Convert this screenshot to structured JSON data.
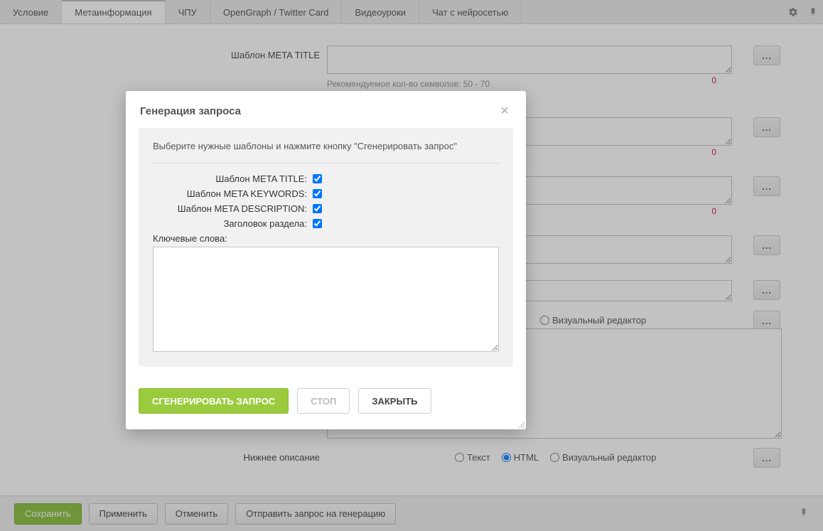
{
  "tabs": [
    {
      "label": "Условие"
    },
    {
      "label": "Метаинформация"
    },
    {
      "label": "ЧПУ"
    },
    {
      "label": "OpenGraph / Twitter Card"
    },
    {
      "label": "Видеоуроки"
    },
    {
      "label": "Чат с нейросетью"
    }
  ],
  "active_tab_index": 1,
  "fields": {
    "meta_title": {
      "label": "Шаблон META TITLE",
      "helper": "Рекомендуемое кол-во символов: 50 - 70",
      "counter": "0"
    },
    "f2": {
      "counter": "0"
    },
    "f3": {
      "counter": "0"
    }
  },
  "desc_label": "Нижнее описание",
  "radios1": {
    "visual": "Визуальный редактор"
  },
  "radios2": {
    "text": "Текст",
    "html": "HTML",
    "visual": "Визуальный редактор"
  },
  "bottom": {
    "save": "Сохранить",
    "apply": "Применить",
    "cancel": "Отменить",
    "send": "Отправить запрос на генерацию"
  },
  "modal": {
    "title": "Генерация запроса",
    "instruction": "Выберите нужные шаблоны и нажмите кнопку \"Сгенерировать запрос\"",
    "checks": [
      {
        "label": "Шаблон META TITLE:",
        "checked": true
      },
      {
        "label": "Шаблон META KEYWORDS:",
        "checked": true
      },
      {
        "label": "Шаблон META DESCRIPTION:",
        "checked": true
      },
      {
        "label": "Заголовок раздела:",
        "checked": true
      }
    ],
    "keywords_label": "Ключевые слова:",
    "buttons": {
      "generate": "СГЕНЕРИРОВАТЬ ЗАПРОС",
      "stop": "СТОП",
      "close": "ЗАКРЫТЬ"
    }
  }
}
